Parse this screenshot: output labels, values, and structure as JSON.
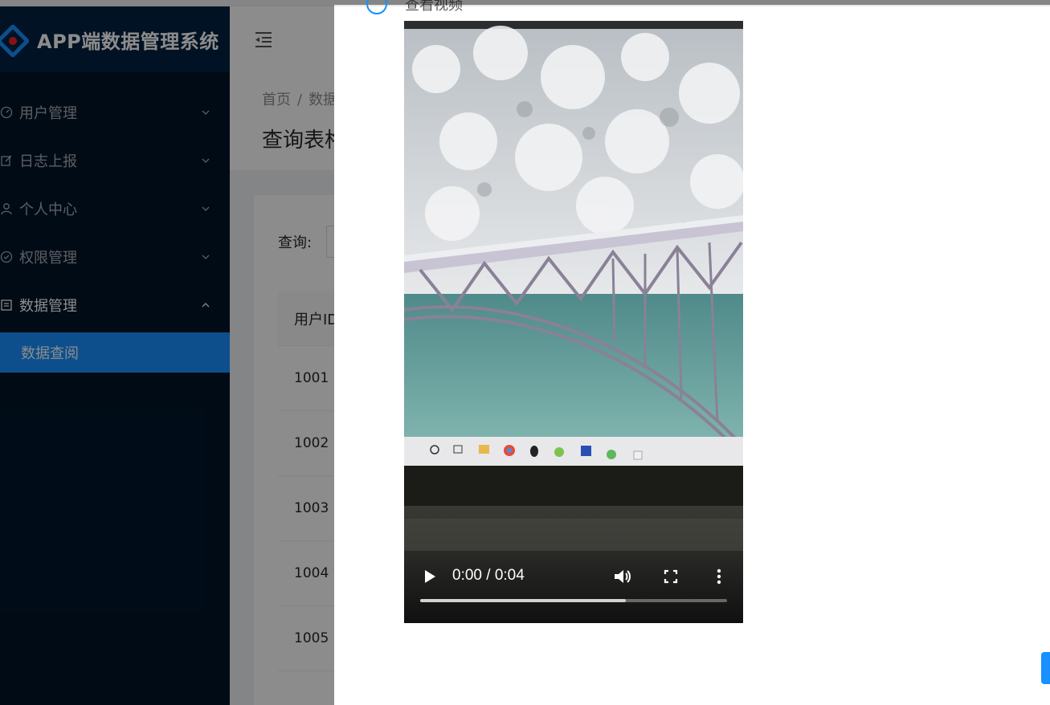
{
  "app": {
    "title": "APP端数据管理系统"
  },
  "sidebar": {
    "items": [
      {
        "label": "用户管理",
        "icon": "dashboard-icon"
      },
      {
        "label": "日志上报",
        "icon": "edit-icon"
      },
      {
        "label": "个人中心",
        "icon": "user-icon"
      },
      {
        "label": "权限管理",
        "icon": "check-circle-icon"
      },
      {
        "label": "数据管理",
        "icon": "profile-icon"
      }
    ],
    "active_sub": {
      "label": "数据查阅"
    }
  },
  "breadcrumb": {
    "home": "首页",
    "separator": "/",
    "current": "数据"
  },
  "page": {
    "title": "查询表格"
  },
  "query": {
    "label": "查询:"
  },
  "table": {
    "header": "用户ID",
    "rows": [
      "1001",
      "1002",
      "1003",
      "1004",
      "1005"
    ]
  },
  "drawer": {
    "label": "查看视频"
  },
  "video": {
    "time": "0:00 / 0:04",
    "buffered_fraction": 0.67
  },
  "colors": {
    "sidebar": "#001529",
    "accent": "#1890ff"
  }
}
